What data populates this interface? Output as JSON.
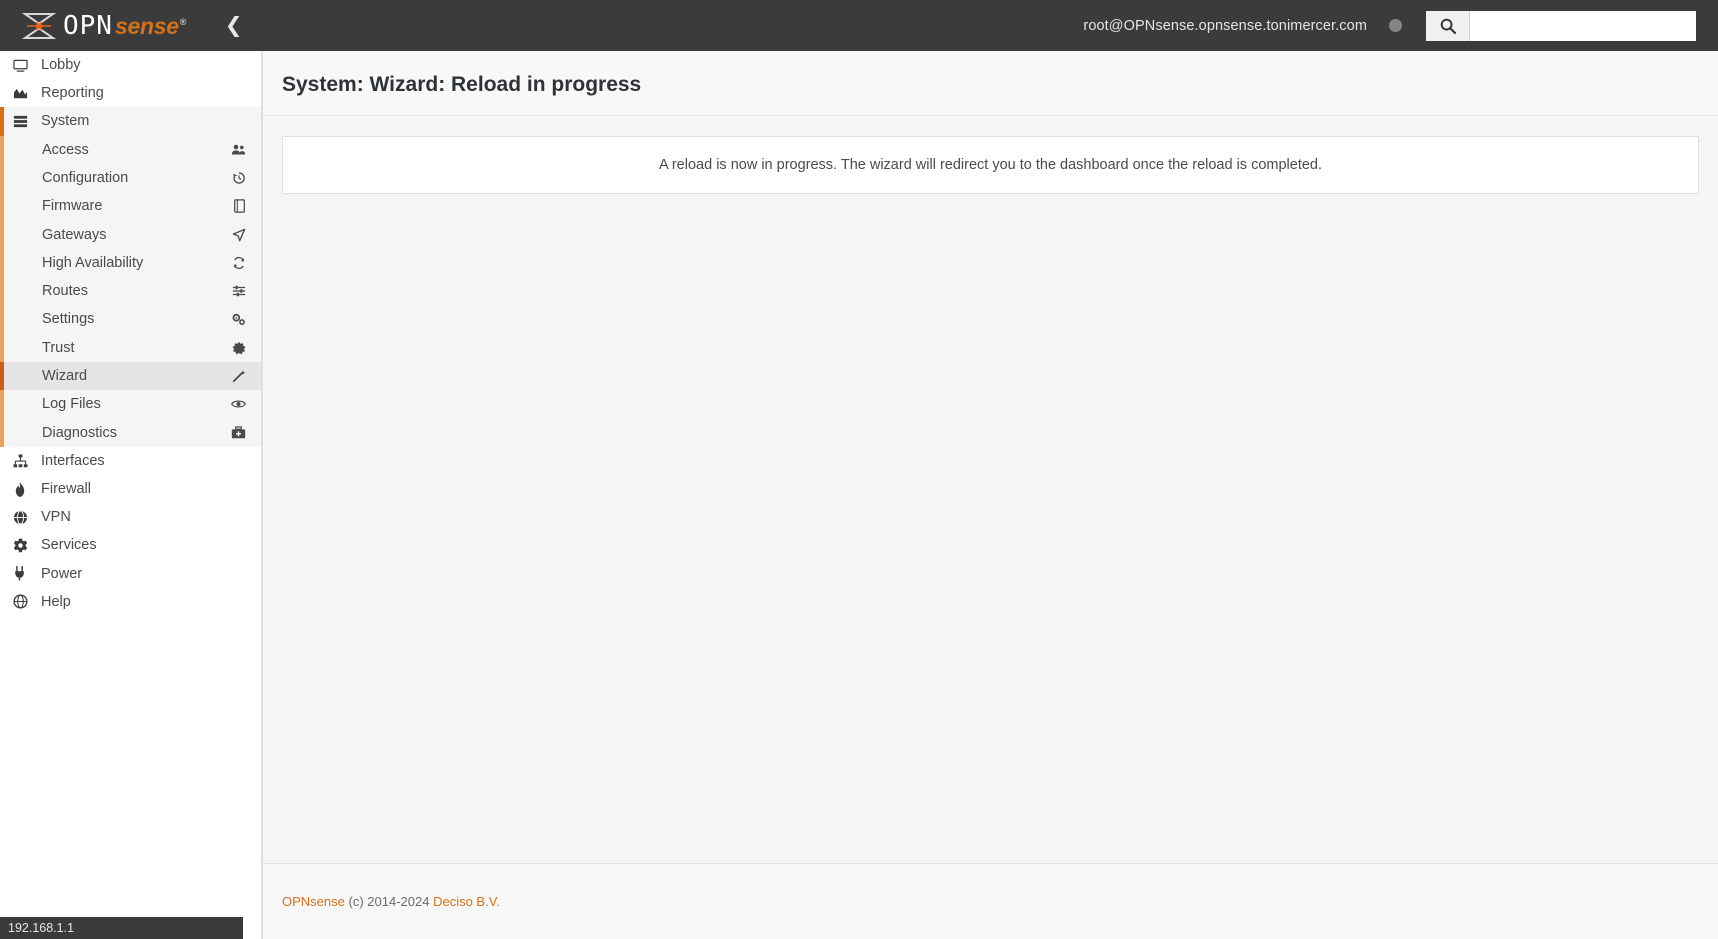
{
  "header": {
    "logo_opn": "OPN",
    "logo_sense": "sense",
    "logo_registered": "®",
    "collapse_icon": "chevron-left",
    "user": "root@OPNsense.opnsense.tonimercer.com",
    "search_placeholder": "",
    "search_value": "",
    "search_icon": "search-icon",
    "colors": {
      "bar": "#3b3b3b",
      "accent": "#d4721a",
      "status_dot": "#858585"
    }
  },
  "sidebar": {
    "top_items": [
      {
        "label": "Lobby",
        "icon": "desktop-icon"
      },
      {
        "label": "Reporting",
        "icon": "chart-area-icon"
      }
    ],
    "system": {
      "label": "System",
      "icon": "server-icon",
      "expanded": true
    },
    "system_children": [
      {
        "label": "Access",
        "icon": "users-icon"
      },
      {
        "label": "Configuration",
        "icon": "history-icon"
      },
      {
        "label": "Firmware",
        "icon": "book-icon"
      },
      {
        "label": "Gateways",
        "icon": "location-arrow-icon"
      },
      {
        "label": "High Availability",
        "icon": "refresh-icon"
      },
      {
        "label": "Routes",
        "icon": "sliders-icon"
      },
      {
        "label": "Settings",
        "icon": "cogs-icon"
      },
      {
        "label": "Trust",
        "icon": "certificate-icon"
      },
      {
        "label": "Wizard",
        "icon": "magic-wand-icon",
        "active": true
      },
      {
        "label": "Log Files",
        "icon": "eye-icon"
      },
      {
        "label": "Diagnostics",
        "icon": "medkit-icon"
      }
    ],
    "bottom_items": [
      {
        "label": "Interfaces",
        "icon": "sitemap-icon"
      },
      {
        "label": "Firewall",
        "icon": "fire-icon"
      },
      {
        "label": "VPN",
        "icon": "globe-icon"
      },
      {
        "label": "Services",
        "icon": "gear-icon"
      },
      {
        "label": "Power",
        "icon": "plug-icon"
      },
      {
        "label": "Help",
        "icon": "globe-help-icon"
      }
    ],
    "ip_address": "192.168.1.1"
  },
  "main": {
    "title": "System: Wizard: Reload in progress",
    "message": "A reload is now in progress. The wizard will redirect you to the dashboard once the reload is completed."
  },
  "footer": {
    "brand_link": "OPNsense",
    "copyright": "(c) 2014-2024",
    "company_link": "Deciso B.V."
  }
}
